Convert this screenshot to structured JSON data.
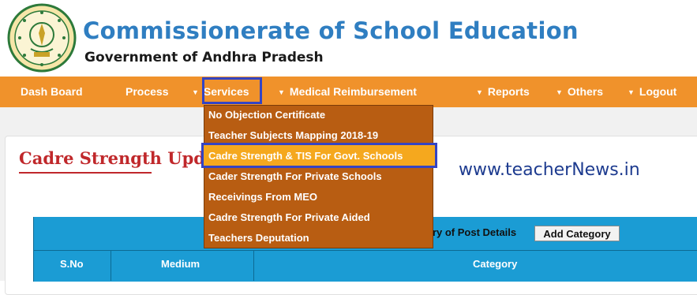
{
  "header": {
    "title": "Commissionerate of School Education",
    "subtitle": "Government of Andhra Pradesh",
    "logo_icon": "andhra-pradesh-emblem-icon"
  },
  "nav": {
    "items": [
      {
        "label": "Dash Board",
        "arrow": false
      },
      {
        "label": "Process",
        "arrow": false
      },
      {
        "label": "Services",
        "arrow": true
      },
      {
        "label": "Medical Reimbursement",
        "arrow": true
      },
      {
        "label": "Reports",
        "arrow": true
      },
      {
        "label": "Others",
        "arrow": true
      },
      {
        "label": "Logout",
        "arrow": true
      }
    ],
    "arrow_glyph": "▼",
    "active": "Services"
  },
  "services_menu": {
    "items": [
      "No Objection Certificate",
      "Teacher Subjects Mapping 2018-19",
      "Cadre Strength & TIS For Govt. Schools",
      "Cader Strength For Private Schools",
      "Receivings From MEO",
      "Cadre Strength For Private Aided",
      "Teachers Deputation"
    ],
    "highlighted": "Cadre Strength & TIS For Govt. Schools"
  },
  "page": {
    "title": "Cadre Strength Updatio",
    "watermark": "www.teacherNews.in"
  },
  "table": {
    "header_text": "ory of Post Details",
    "add_button": "Add Category",
    "columns": [
      "S.No",
      "Medium",
      "Category"
    ]
  },
  "colors": {
    "nav_bg": "#f0922b",
    "title_blue": "#2f7ec1",
    "dropdown_bg": "#b85d12",
    "highlight": "#f5a81e",
    "annotation_border": "#3344c4",
    "table_header": "#1b9cd4",
    "page_title_red": "#c0282b"
  }
}
